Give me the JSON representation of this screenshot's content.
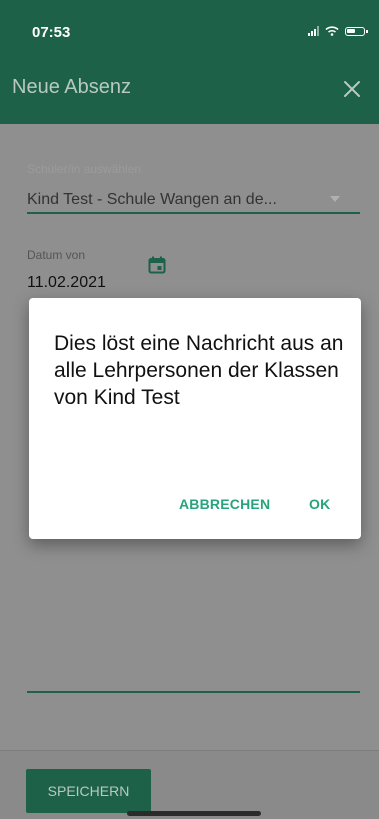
{
  "status_bar": {
    "time": "07:53"
  },
  "app_bar": {
    "title": "Neue Absenz",
    "close_icon": "close-icon"
  },
  "form": {
    "student": {
      "label": "Schüler/in auswählen",
      "value": "Kind Test - Schule Wangen an de..."
    },
    "date_from": {
      "label": "Datum von",
      "value": "11.02.2021"
    }
  },
  "dialog": {
    "message": "Dies löst eine Nachricht aus an alle Lehrpersonen der Klassen von Kind Test",
    "cancel_label": "ABBRECHEN",
    "ok_label": "OK"
  },
  "footer": {
    "save_label": "SPEICHERN"
  },
  "colors": {
    "primary": "#1d6148",
    "accent": "#26a47c",
    "scrim": "#8f8f8f"
  }
}
